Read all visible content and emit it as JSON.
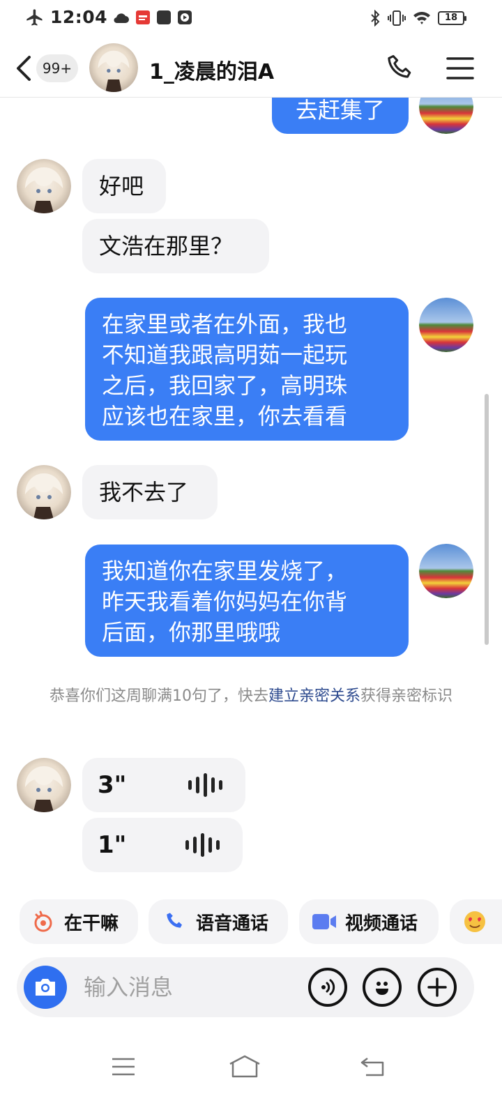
{
  "status_bar": {
    "time": "12:04",
    "battery": "18"
  },
  "header": {
    "badge": "99+",
    "title": "1_凌晨的泪A"
  },
  "messages": {
    "m0": "去赶集了",
    "m1": "好吧",
    "m2": "文浩在那里？",
    "m3_lines": [
      "在家里或者在外面，我也",
      "不知道我跟高明茹一起玩",
      "之后，我回家了，高明珠",
      "应该也在家里，你去看看"
    ],
    "m4": "我不去了",
    "m5_lines": [
      "我知道你在家里发烧了，",
      "昨天我看着你妈妈在你背",
      "后面，你那里哦哦"
    ],
    "notice_pre": "恭喜你们这周聊满10句了，快去",
    "notice_link": "建立亲密关系",
    "notice_post": "获得亲密标识",
    "voice1": "3\"",
    "voice2": "1\""
  },
  "chips": {
    "c1": "在干嘛",
    "c2": "语音通话",
    "c3": "视频通话"
  },
  "input": {
    "placeholder": "输入消息"
  },
  "colors": {
    "outgoing_bubble": "#3a7ef5",
    "incoming_bubble": "#f3f3f5",
    "camera_button": "#2f6ff0",
    "link": "#2e4b8f"
  },
  "icons": [
    "airplane-icon",
    "cloud-icon",
    "app-badge-icon",
    "square-icon",
    "play-icon",
    "bluetooth-icon",
    "vibrate-icon",
    "wifi-icon",
    "battery-icon",
    "back-icon",
    "phone-icon",
    "menu-icon",
    "camera-icon",
    "voice-icon",
    "emoji-icon",
    "plus-icon",
    "video-icon",
    "heart-eyes-icon",
    "wave-icon"
  ]
}
